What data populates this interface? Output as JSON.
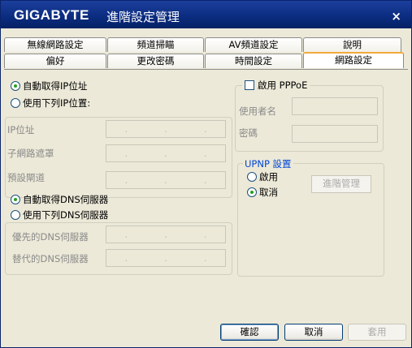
{
  "titlebar": {
    "logo": "GIGABYTE",
    "title": "進階設定管理",
    "close": "×"
  },
  "tabs_row1": [
    "無線網路設定",
    "頻道掃瞄",
    "AV頻道設定",
    "說明"
  ],
  "tabs_row2": [
    "偏好",
    "更改密碼",
    "時間設定",
    "網路設定"
  ],
  "active_tab": "網路設定",
  "ip": {
    "auto_ip": "自動取得IP位址",
    "manual_ip": "使用下列IP位置:",
    "ip_address": "IP位址",
    "subnet_mask": "子網路遮罩",
    "gateway": "預設閘道",
    "auto_dns": "自動取得DNS伺服器",
    "manual_dns": "使用下列DNS伺服器",
    "preferred_dns": "優先的DNS伺服器",
    "alternate_dns": "替代的DNS伺服器",
    "dot": "."
  },
  "pppoe": {
    "enable": "啟用 PPPoE",
    "username": "使用者名",
    "password": "密碼"
  },
  "upnp": {
    "legend": "UPNP 設置",
    "on": "啟用",
    "off": "取消",
    "advanced": "進階管理"
  },
  "buttons": {
    "ok": "確認",
    "cancel": "取消",
    "apply": "套用"
  }
}
